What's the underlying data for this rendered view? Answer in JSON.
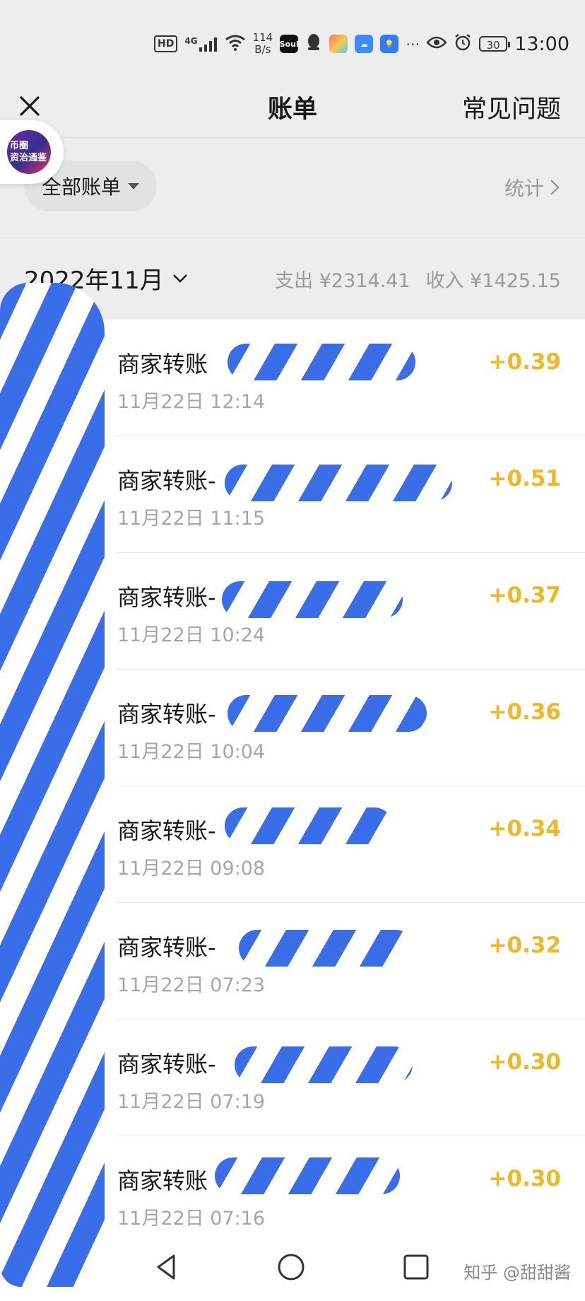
{
  "status_bar": {
    "hd_badge": "HD",
    "network_type": "4G",
    "speed_value": "114",
    "speed_unit": "B/s",
    "soul_app_label": "Soul",
    "battery_level": "30",
    "time": "13:00",
    "icons": [
      "hd-icon",
      "signal-icon",
      "wifi-icon",
      "soul-app-icon",
      "qq-icon",
      "app-icon",
      "cloud-icon",
      "bulb-icon",
      "more-icon",
      "eye-icon",
      "alarm-icon",
      "battery-icon"
    ]
  },
  "titlebar": {
    "title": "账单",
    "faq_label": "常见问题"
  },
  "floating_badge": {
    "line1": "币圈",
    "line2": "资治通鉴"
  },
  "filter": {
    "label": "全部账单",
    "stats_label": "统计"
  },
  "month": {
    "label": "2022年11月",
    "expense": "支出 ¥2314.41",
    "income": "收入 ¥1425.15"
  },
  "transactions": [
    {
      "name": "商家转账",
      "time": "11月22日 12:14",
      "amount": "+0.39"
    },
    {
      "name": "商家转账-",
      "time": "11月22日 11:15",
      "amount": "+0.51"
    },
    {
      "name": "商家转账-",
      "time": "11月22日 10:24",
      "amount": "+0.37"
    },
    {
      "name": "商家转账-",
      "time": "11月22日 10:04",
      "amount": "+0.36"
    },
    {
      "name": "商家转账-",
      "time": "11月22日 09:08",
      "amount": "+0.34"
    },
    {
      "name": "商家转账-",
      "time": "11月22日 07:23",
      "amount": "+0.32"
    },
    {
      "name": "商家转账-",
      "time": "11月22日 07:19",
      "amount": "+0.30"
    },
    {
      "name": "商家转账",
      "time": "11月22日 07:16",
      "amount": "+0.30"
    }
  ],
  "watermark": "知乎 @甜甜酱",
  "colors": {
    "amount": "#f2b824",
    "redaction": "#3a6ee8",
    "background": "#ededed"
  }
}
